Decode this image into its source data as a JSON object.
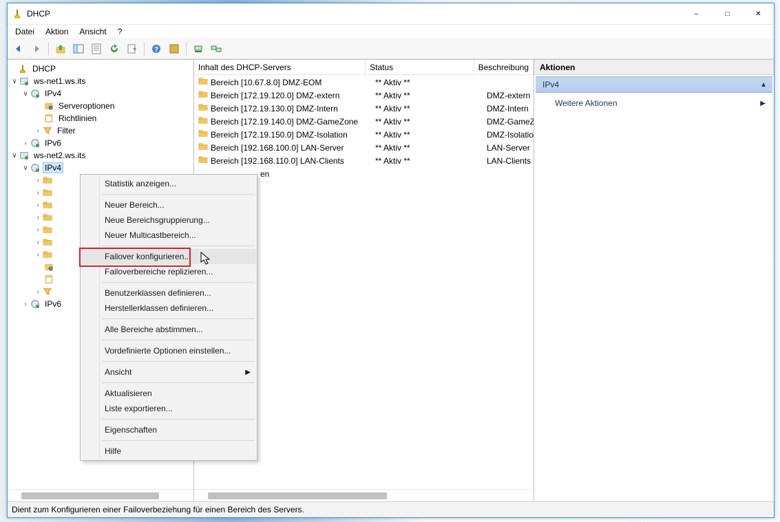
{
  "window": {
    "title": "DHCP"
  },
  "menus": {
    "file": "Datei",
    "action": "Aktion",
    "view": "Ansicht",
    "help": "?"
  },
  "tree": {
    "root": "DHCP",
    "server1": {
      "name": "ws-net1.ws.its",
      "ipv4": "IPv4",
      "ipv6": "IPv6",
      "serveroptions": "Serveroptionen",
      "policies": "Richtlinien",
      "filter": "Filter"
    },
    "server2": {
      "name": "ws-net2.ws.its",
      "ipv4": "IPv4",
      "ipv6": "IPv6"
    }
  },
  "list": {
    "columns": {
      "c1": "Inhalt des DHCP-Servers",
      "c2": "Status",
      "c3": "Beschreibung"
    },
    "rows": [
      {
        "name": "Bereich [10.67.8.0] DMZ-EOM",
        "status": "** Aktiv **",
        "desc": ""
      },
      {
        "name": "Bereich [172.19.120.0] DMZ-extern",
        "status": "** Aktiv **",
        "desc": "DMZ-extern"
      },
      {
        "name": "Bereich [172.19.130.0] DMZ-Intern",
        "status": "** Aktiv **",
        "desc": "DMZ-Intern"
      },
      {
        "name": "Bereich [172.19.140.0] DMZ-GameZone",
        "status": "** Aktiv **",
        "desc": "DMZ-GameZone"
      },
      {
        "name": "Bereich [172.19.150.0] DMZ-Isolation",
        "status": "** Aktiv **",
        "desc": "DMZ-Isolation"
      },
      {
        "name": "Bereich [192.168.100.0] LAN-Server",
        "status": "** Aktiv **",
        "desc": "LAN-Server"
      },
      {
        "name": "Bereich [192.168.110.0] LAN-Clients",
        "status": "** Aktiv **",
        "desc": "LAN-Clients"
      }
    ],
    "extra_truncated": "en"
  },
  "actions": {
    "header": "Aktionen",
    "section": "IPv4",
    "more": "Weitere Aktionen"
  },
  "context": {
    "items": [
      {
        "label": "Statistik anzeigen..."
      },
      {
        "sep": true
      },
      {
        "label": "Neuer Bereich..."
      },
      {
        "label": "Neue Bereichsgruppierung..."
      },
      {
        "label": "Neuer Multicastbereich..."
      },
      {
        "sep": true
      },
      {
        "label": "Failover konfigurieren...",
        "hover": true,
        "highlight": true
      },
      {
        "label": "Failoverbereiche replizieren..."
      },
      {
        "sep": true
      },
      {
        "label": "Benutzerklassen definieren..."
      },
      {
        "label": "Herstellerklassen definieren..."
      },
      {
        "sep": true
      },
      {
        "label": "Alle Bereiche abstimmen..."
      },
      {
        "sep": true
      },
      {
        "label": "Vordefinierte Optionen einstellen..."
      },
      {
        "sep": true
      },
      {
        "label": "Ansicht",
        "submenu": true
      },
      {
        "sep": true
      },
      {
        "label": "Aktualisieren"
      },
      {
        "label": "Liste exportieren..."
      },
      {
        "sep": true
      },
      {
        "label": "Eigenschaften"
      },
      {
        "sep": true
      },
      {
        "label": "Hilfe"
      }
    ]
  },
  "status": "Dient zum Konfigurieren einer Failoverbeziehung für einen Bereich des Servers."
}
